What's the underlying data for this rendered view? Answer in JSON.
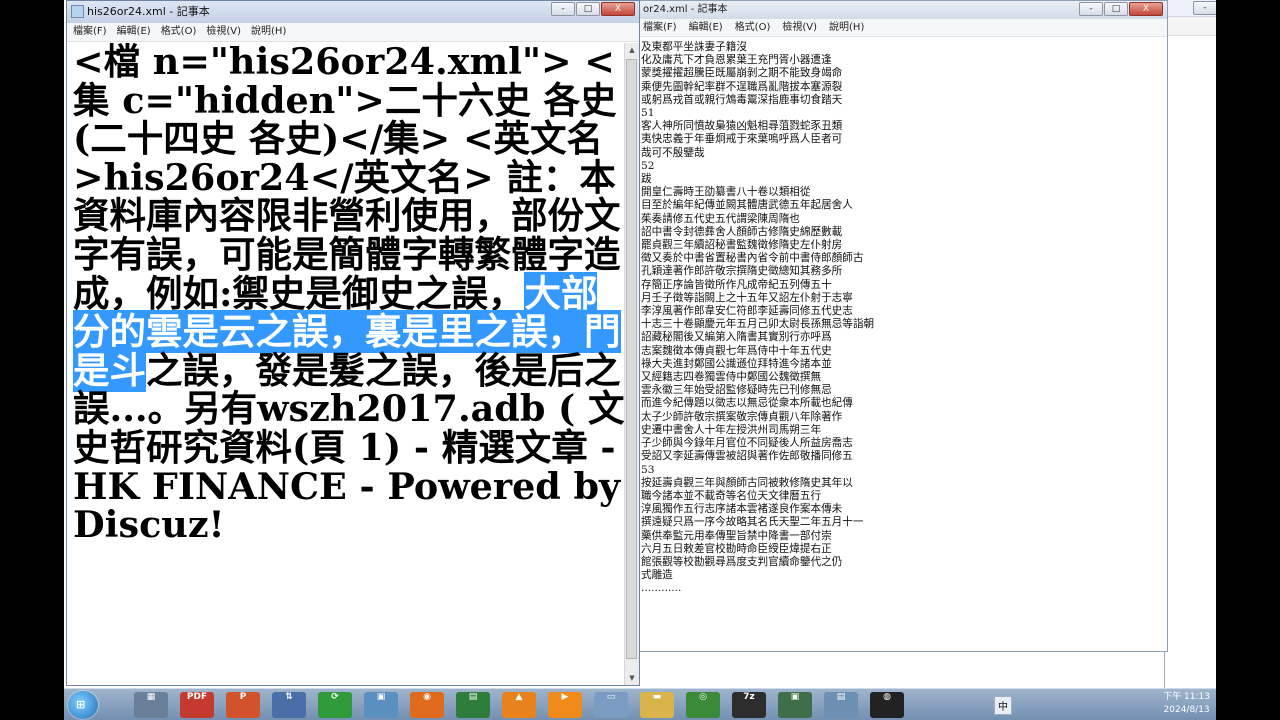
{
  "left_window": {
    "title": "his26or24.xml - 記事本",
    "menu": [
      "檔案(F)",
      "編輯(E)",
      "格式(O)",
      "檢視(V)",
      "說明(H)"
    ],
    "window_buttons": [
      "-",
      "□",
      "X"
    ],
    "content_before": "<檔 n=\"his26or24.xml\"> <集 c=\"hidden\">二十六史 各史 (二十四史 各史)</集> <英文名>his26or24</英文名> 註：本資料庫內容限非營利使用，部份文字有誤，可能是簡體字轉繁體字造成，例如:禦史是御史之誤，",
    "content_selected": "大部分的雲是云之誤，裏是里之誤，門是斗",
    "content_after": "之誤，發是髮之誤，後是后之誤...。另有wszh2017.adb ( 文史哲研究資料(頁 1) - 精選文章 - HK FINANCE - Powered by Discuz!"
  },
  "right_window": {
    "title": "or24.xml - 記事本",
    "menu": [
      "檔案(F)",
      "編輯(E)",
      "格式(O)",
      "檢視(V)",
      "說明(H)"
    ],
    "window_buttons": [
      "-",
      "□",
      "X"
    ],
    "lines": [
      "及東都平坐誅妻子籍沒",
      "化及庸芃下才負恩累葉王充門胥小器遭逢",
      "蒙獎擢擢超騰臣既屬崩剝之期不能致身竭命",
      "乘便先圖幹紀率群不逞職爲亂階拔本塞源裂",
      "或躬爲戎首或親行鴆毒鬻深指鹿事切食踏天",
      "51",
      "客人神所同憤故梟猿凶魁相尋菹戮蛇豕丑類",
      "夷快忠義于年垂炯戒于來葉嗚呼爲人臣者可",
      "哉可不殷鑒哉",
      "52",
      "跋",
      "開皇仁壽時王劭纂書八十卷以類相從",
      "目至於編年紀傳並闕其體唐武德五年起居舍人",
      "茱奏請修五代史五代謂梁陳周隋也",
      "詔中書令封德彝舍人顏師古修隋史綿歷數載",
      "罷貞觀三年續詔秘書監魏徵修隋史左仆射房",
      "徵又奏於中書省置秘書內省令前中書侍郎顏師古",
      "孔穎達著作郎許敬宗撰隋史徵總知其務多所",
      "存簡正序論皆徵所作凡成帝紀五列傳五十",
      "月壬子徵等詣闕上之十五年又詔左仆射于志寧",
      "李淳風著作郎韋安仁符郎李延壽同修五代史志",
      "十志三十卷顯慶元年五月己卯太尉長孫無忌等詣朝",
      "詔藏秘閣後又編第入隋書其實別行亦呼爲",
      "志案魏徵本傳貞觀七年爲侍中十年五代史",
      "祿大夫進封鄭國公識遜位拜特進今諸本並",
      "又經籍志四卷獨雲侍中鄭國公魏徵撰無",
      "雲永徽三年始受詔監修疑時先已刊修無忌",
      "而進今紀傳題以徵志以無忌從衆本所載也紀傳",
      "太子少師許敬宗撰案敬宗傳貞觀八年除著作",
      "史遷中書舍人十年左授洪州司馬朔三年",
      "子少師與今錄年月官位不同疑後人所益房喬志",
      "受詔又李延壽傳雲被詔與著作佐郎敬播同修五",
      "53",
      "按延壽貞觀三年與顏師古同被敕修隋史其年以",
      "職今諸本並不載奇等名位天文律曆五行",
      "淳風獨作五行志序諸本雲褚遂良作案本傳未",
      "撰遠疑只爲一序今故略其名氏天聖二年五月十一",
      "藥供奉監元用奉傳聖旨禁中降書一部付崇",
      "六月五日敕差官校勘時命臣綬臣煒提右正",
      "館張觀等校勘觀尋爲度支判官續命鑒代之仍",
      "式雕造",
      "............"
    ]
  },
  "far_right_window": {
    "window_buttons": [
      "-",
      "□",
      "X"
    ]
  },
  "taskbar": {
    "start_label": "⊞",
    "apps": [
      {
        "name": "app-shortcut",
        "glyph": "▦",
        "color": "#6a7f99"
      },
      {
        "name": "pdf-app",
        "glyph": "PDF",
        "color": "#c43a2f"
      },
      {
        "name": "powerpoint-app",
        "glyph": "P",
        "color": "#d2532b"
      },
      {
        "name": "network-app",
        "glyph": "⇅",
        "color": "#4a6fa8"
      },
      {
        "name": "sync-app",
        "glyph": "⟳",
        "color": "#2e9a3a"
      },
      {
        "name": "image-app",
        "glyph": "▣",
        "color": "#5b8fbf"
      },
      {
        "name": "firefox-app",
        "glyph": "◉",
        "color": "#e06a1b"
      },
      {
        "name": "excel-app",
        "glyph": "▤",
        "color": "#2f7d3b"
      },
      {
        "name": "vlc-app",
        "glyph": "▲",
        "color": "#e8821c"
      },
      {
        "name": "media-app",
        "glyph": "▶",
        "color": "#f08a1a"
      },
      {
        "name": "window-app",
        "glyph": "▭",
        "color": "#7a9cc2"
      },
      {
        "name": "folder-app",
        "glyph": "▬",
        "color": "#d8b44a"
      },
      {
        "name": "chrome-app",
        "glyph": "◎",
        "color": "#3a8a3a"
      },
      {
        "name": "7zip-app",
        "glyph": "7z",
        "color": "#2d2d2d"
      },
      {
        "name": "monitor-app",
        "glyph": "▣",
        "color": "#3f6e4a"
      },
      {
        "name": "notepad-app",
        "glyph": "▤",
        "color": "#6d8fb3"
      },
      {
        "name": "recorder-app",
        "glyph": "◍",
        "color": "#222222"
      }
    ],
    "ime": "中",
    "clock_time": "下午 11:13",
    "clock_date": "2024/8/13"
  }
}
